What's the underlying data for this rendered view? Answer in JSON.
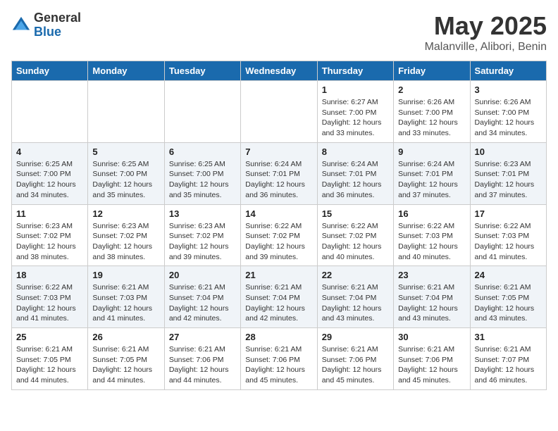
{
  "header": {
    "logo_general": "General",
    "logo_blue": "Blue",
    "month_title": "May 2025",
    "location": "Malanville, Alibori, Benin"
  },
  "weekdays": [
    "Sunday",
    "Monday",
    "Tuesday",
    "Wednesday",
    "Thursday",
    "Friday",
    "Saturday"
  ],
  "weeks": [
    [
      {
        "day": "",
        "info": ""
      },
      {
        "day": "",
        "info": ""
      },
      {
        "day": "",
        "info": ""
      },
      {
        "day": "",
        "info": ""
      },
      {
        "day": "1",
        "info": "Sunrise: 6:27 AM\nSunset: 7:00 PM\nDaylight: 12 hours\nand 33 minutes."
      },
      {
        "day": "2",
        "info": "Sunrise: 6:26 AM\nSunset: 7:00 PM\nDaylight: 12 hours\nand 33 minutes."
      },
      {
        "day": "3",
        "info": "Sunrise: 6:26 AM\nSunset: 7:00 PM\nDaylight: 12 hours\nand 34 minutes."
      }
    ],
    [
      {
        "day": "4",
        "info": "Sunrise: 6:25 AM\nSunset: 7:00 PM\nDaylight: 12 hours\nand 34 minutes."
      },
      {
        "day": "5",
        "info": "Sunrise: 6:25 AM\nSunset: 7:00 PM\nDaylight: 12 hours\nand 35 minutes."
      },
      {
        "day": "6",
        "info": "Sunrise: 6:25 AM\nSunset: 7:00 PM\nDaylight: 12 hours\nand 35 minutes."
      },
      {
        "day": "7",
        "info": "Sunrise: 6:24 AM\nSunset: 7:01 PM\nDaylight: 12 hours\nand 36 minutes."
      },
      {
        "day": "8",
        "info": "Sunrise: 6:24 AM\nSunset: 7:01 PM\nDaylight: 12 hours\nand 36 minutes."
      },
      {
        "day": "9",
        "info": "Sunrise: 6:24 AM\nSunset: 7:01 PM\nDaylight: 12 hours\nand 37 minutes."
      },
      {
        "day": "10",
        "info": "Sunrise: 6:23 AM\nSunset: 7:01 PM\nDaylight: 12 hours\nand 37 minutes."
      }
    ],
    [
      {
        "day": "11",
        "info": "Sunrise: 6:23 AM\nSunset: 7:02 PM\nDaylight: 12 hours\nand 38 minutes."
      },
      {
        "day": "12",
        "info": "Sunrise: 6:23 AM\nSunset: 7:02 PM\nDaylight: 12 hours\nand 38 minutes."
      },
      {
        "day": "13",
        "info": "Sunrise: 6:23 AM\nSunset: 7:02 PM\nDaylight: 12 hours\nand 39 minutes."
      },
      {
        "day": "14",
        "info": "Sunrise: 6:22 AM\nSunset: 7:02 PM\nDaylight: 12 hours\nand 39 minutes."
      },
      {
        "day": "15",
        "info": "Sunrise: 6:22 AM\nSunset: 7:02 PM\nDaylight: 12 hours\nand 40 minutes."
      },
      {
        "day": "16",
        "info": "Sunrise: 6:22 AM\nSunset: 7:03 PM\nDaylight: 12 hours\nand 40 minutes."
      },
      {
        "day": "17",
        "info": "Sunrise: 6:22 AM\nSunset: 7:03 PM\nDaylight: 12 hours\nand 41 minutes."
      }
    ],
    [
      {
        "day": "18",
        "info": "Sunrise: 6:22 AM\nSunset: 7:03 PM\nDaylight: 12 hours\nand 41 minutes."
      },
      {
        "day": "19",
        "info": "Sunrise: 6:21 AM\nSunset: 7:03 PM\nDaylight: 12 hours\nand 41 minutes."
      },
      {
        "day": "20",
        "info": "Sunrise: 6:21 AM\nSunset: 7:04 PM\nDaylight: 12 hours\nand 42 minutes."
      },
      {
        "day": "21",
        "info": "Sunrise: 6:21 AM\nSunset: 7:04 PM\nDaylight: 12 hours\nand 42 minutes."
      },
      {
        "day": "22",
        "info": "Sunrise: 6:21 AM\nSunset: 7:04 PM\nDaylight: 12 hours\nand 43 minutes."
      },
      {
        "day": "23",
        "info": "Sunrise: 6:21 AM\nSunset: 7:04 PM\nDaylight: 12 hours\nand 43 minutes."
      },
      {
        "day": "24",
        "info": "Sunrise: 6:21 AM\nSunset: 7:05 PM\nDaylight: 12 hours\nand 43 minutes."
      }
    ],
    [
      {
        "day": "25",
        "info": "Sunrise: 6:21 AM\nSunset: 7:05 PM\nDaylight: 12 hours\nand 44 minutes."
      },
      {
        "day": "26",
        "info": "Sunrise: 6:21 AM\nSunset: 7:05 PM\nDaylight: 12 hours\nand 44 minutes."
      },
      {
        "day": "27",
        "info": "Sunrise: 6:21 AM\nSunset: 7:06 PM\nDaylight: 12 hours\nand 44 minutes."
      },
      {
        "day": "28",
        "info": "Sunrise: 6:21 AM\nSunset: 7:06 PM\nDaylight: 12 hours\nand 45 minutes."
      },
      {
        "day": "29",
        "info": "Sunrise: 6:21 AM\nSunset: 7:06 PM\nDaylight: 12 hours\nand 45 minutes."
      },
      {
        "day": "30",
        "info": "Sunrise: 6:21 AM\nSunset: 7:06 PM\nDaylight: 12 hours\nand 45 minutes."
      },
      {
        "day": "31",
        "info": "Sunrise: 6:21 AM\nSunset: 7:07 PM\nDaylight: 12 hours\nand 46 minutes."
      }
    ]
  ]
}
